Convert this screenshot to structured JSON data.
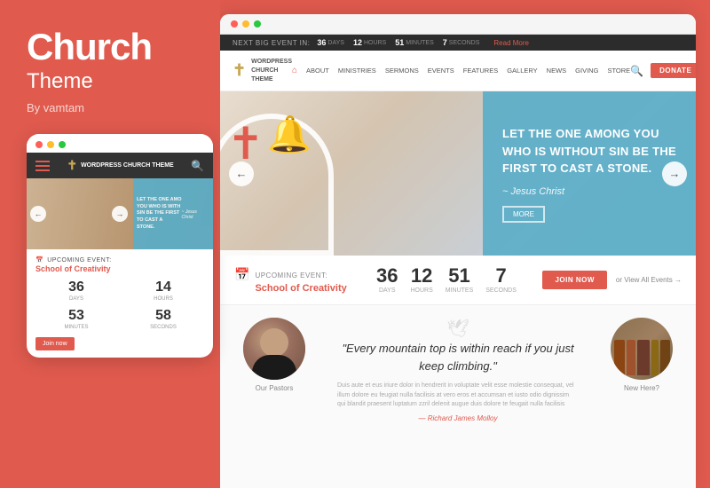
{
  "left": {
    "title": "Church",
    "subtitle": "Theme",
    "by": "By vamtam",
    "dots": [
      "red",
      "yellow",
      "green"
    ],
    "mobile": {
      "logo_text": "WORDPRESS\nCHURCH\nTHEME",
      "upcoming_label": "UPCOMING EVENT:",
      "event_name": "School of Creativity",
      "countdown": {
        "days": "36",
        "days_label": "DAYS",
        "hours": "14",
        "hours_label": "HOURS",
        "minutes": "53",
        "minutes_label": "MINUTES",
        "seconds": "58",
        "seconds_label": "SECONDS"
      },
      "join_button": "Join now"
    }
  },
  "right": {
    "titlebar_dots": [
      "red",
      "yellow",
      "green"
    ],
    "event_banner": {
      "label": "NEXT BIG EVENT IN:",
      "days": "36",
      "days_unit": "DAYS",
      "hours": "12",
      "hours_unit": "HOURS",
      "minutes": "51",
      "minutes_unit": "MINUTES",
      "seconds": "7",
      "seconds_unit": "SECONDS",
      "more_link": "Read More"
    },
    "nav": {
      "logo_text": "WORDPRESS\nCHURCH\nTHEME",
      "links": [
        "ABOUT",
        "MINISTRIES",
        "SERMONS",
        "EVENTS",
        "FEATURES",
        "GALLERY",
        "NEWS",
        "GIVING",
        "STORE"
      ],
      "donate_label": "Donate"
    },
    "hero": {
      "quote": "LET THE ONE AMONG YOU WHO IS WITHOUT SIN BE THE FIRST TO CAST A STONE.",
      "author": "~ Jesus Christ",
      "button_label": "MORE"
    },
    "event_bar": {
      "upcoming_label": "UPCOMING EVENT:",
      "event_name": "School of Creativity",
      "days": "36",
      "days_label": "DAYS",
      "hours": "12",
      "hours_label": "HOURS",
      "minutes": "51",
      "minutes_label": "MINUTES",
      "seconds": "7",
      "seconds_label": "SECONDS",
      "join_label": "Join now",
      "view_all": "or   View All Events →"
    },
    "bottom": {
      "pastor_label": "Our Pastors",
      "quote_icon": "“",
      "main_quote": "\"Every mountain top is within reach if you just keep climbing.\"",
      "quote_body": "Duis aute et eus iriure dolor in hendrerit in voluptate velit esse molestie consequat, vel illum dolore eu feugiat nulla facilisis at vero eros et accumsan et iusto odio dignissim qui blandit praesent luptatum zzril delenit augue duis dolore te feugait nulla facilisis",
      "quote_author": "— Richard James Molloy",
      "new_here_label": "New Here?"
    }
  }
}
